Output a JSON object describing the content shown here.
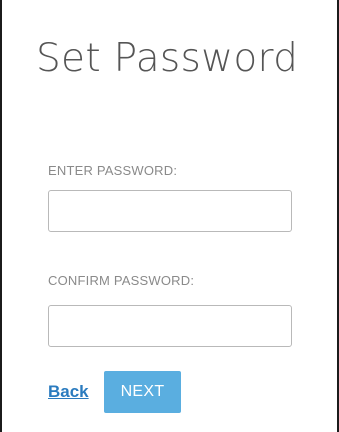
{
  "form": {
    "title": "Set Password",
    "password_label": "ENTER PASSWORD:",
    "password_value": "",
    "confirm_label": "CONFIRM PASSWORD:",
    "confirm_value": ""
  },
  "actions": {
    "back_label": "Back",
    "next_label": "NEXT"
  },
  "colors": {
    "title_text": "#555555",
    "label_text": "#8a8a8a",
    "link": "#2a7bbf",
    "primary_button": "#5aaee0",
    "frame_border": "#1b1b1b",
    "input_border": "#b9b9b9"
  }
}
